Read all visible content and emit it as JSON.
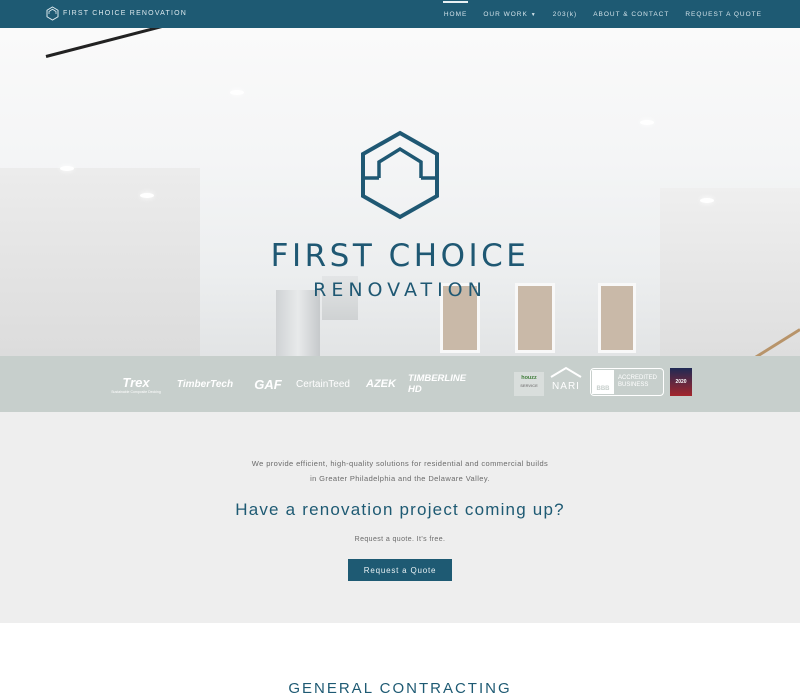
{
  "nav": {
    "brand": "FIRST CHOICE RENOVATION",
    "items": [
      {
        "label": "HOME"
      },
      {
        "label": "OUR WORK"
      },
      {
        "label": "203(k)"
      },
      {
        "label": "ABOUT & CONTACT"
      },
      {
        "label": "REQUEST A QUOTE"
      }
    ],
    "active_item": "HOME"
  },
  "hero": {
    "title": "FIRST CHOICE",
    "subtitle": "RENOVATION"
  },
  "partners": {
    "trex": "Trex",
    "trex_tag": "Sustainable Composite Decking",
    "timbertech": "TimberTech",
    "gaf": "GAF",
    "certainteed": "CertainTeed",
    "azek": "AZEK",
    "timberline": "TIMBERLINE HD",
    "houzz": "houzz",
    "houzz_tag": "SERVICE",
    "nari": "NARI",
    "bbb_seal": "BBB",
    "bbb_text_1": "ACCREDITED",
    "bbb_text_2": "BUSINESS",
    "award": "2020"
  },
  "intro": {
    "line1": "We provide efficient, high-quality solutions for residential and commercial builds",
    "line2": "in Greater Philadelphia and the Delaware Valley.",
    "heading": "Have a renovation project coming up?",
    "small": "Request a quote. It's free.",
    "cta": "Request a Quote"
  },
  "section": {
    "title": "GENERAL CONTRACTING"
  },
  "colors": {
    "brand": "#1e5a73",
    "partner_bar": "#c7cfcc",
    "intro_bg": "#eeeeee"
  }
}
